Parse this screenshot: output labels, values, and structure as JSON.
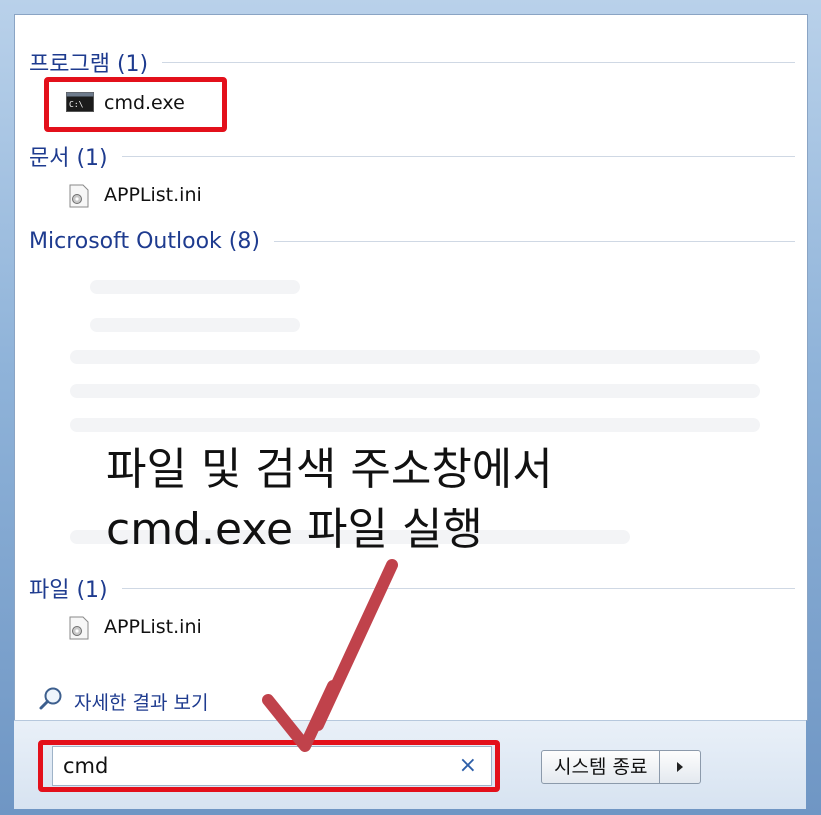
{
  "sections": {
    "programs": {
      "header": "프로그램 (1)",
      "item": "cmd.exe",
      "item_icon": "console-icon"
    },
    "documents": {
      "header": "문서 (1)",
      "item": "APPList.ini",
      "item_icon": "settings-file-icon"
    },
    "outlook": {
      "header": "Microsoft Outlook (8)"
    },
    "files": {
      "header": "파일 (1)",
      "item": "APPList.ini",
      "item_icon": "settings-file-icon"
    }
  },
  "annotation": {
    "line1": "파일 및 검색 주소창에서",
    "line2": "cmd.exe 파일 실행"
  },
  "see_more": {
    "label": "자세한 결과 보기",
    "icon": "search-icon"
  },
  "search": {
    "value": "cmd",
    "clear_icon": "clear-icon"
  },
  "shutdown": {
    "label": "시스템 종료",
    "arrow_icon": "chevron-right-icon"
  },
  "colors": {
    "header_blue": "#1e3b8f",
    "highlight_red": "#e3101b",
    "arrow_red": "#c0424b"
  }
}
